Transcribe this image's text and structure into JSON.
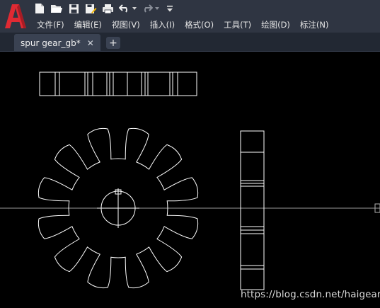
{
  "app": {
    "logo_letter": "A",
    "logo_color": "#e02a33"
  },
  "quick_access": [
    {
      "name": "new-icon"
    },
    {
      "name": "open-icon"
    },
    {
      "name": "save-icon"
    },
    {
      "name": "save-as-icon"
    },
    {
      "name": "print-icon"
    },
    {
      "name": "undo-icon"
    },
    {
      "name": "redo-icon"
    },
    {
      "name": "customize-dropdown-icon"
    }
  ],
  "menu": {
    "file": "文件(F)",
    "edit": "编辑(E)",
    "view": "视图(V)",
    "insert": "插入(I)",
    "format": "格式(O)",
    "tools": "工具(T)",
    "draw": "绘图(D)",
    "dimension": "标注(N)"
  },
  "tabs": {
    "active_label": "spur gear_gb*",
    "close_glyph": "✕",
    "new_tab_glyph": "+"
  },
  "drawing": {
    "line_color": "#ffffff",
    "background": "#000000",
    "gear_teeth": 12
  },
  "watermark": {
    "text": "https://blog.csdn.net/haigear"
  }
}
